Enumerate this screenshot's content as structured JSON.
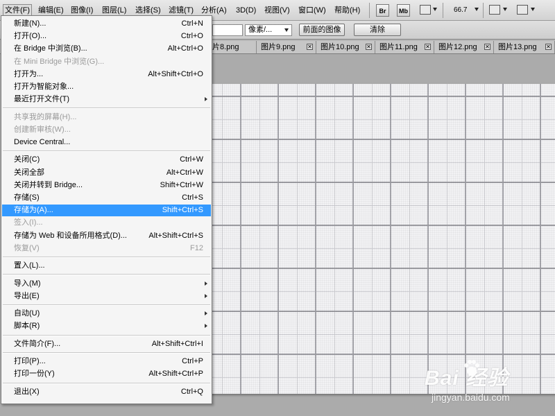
{
  "menubar": {
    "items": [
      "文件(F)",
      "编辑(E)",
      "图像(I)",
      "图层(L)",
      "选择(S)",
      "滤镜(T)",
      "分析(A)",
      "3D(D)",
      "视图(V)",
      "窗口(W)",
      "帮助(H)"
    ],
    "bridge_label": "Br",
    "minibridge_label": "Mb",
    "zoom": "66.7"
  },
  "options": {
    "unit_select": "像素/...",
    "front_image_button": "前面的图像",
    "clear_button": "清除"
  },
  "tabs": [
    "片8.png",
    "图片9.png",
    "图片10.png",
    "图片11.png",
    "图片12.png",
    "图片13.png"
  ],
  "file_menu": {
    "groups": [
      [
        {
          "label": "新建(N)...",
          "shortcut": "Ctrl+N",
          "disabled": false,
          "submenu": false
        },
        {
          "label": "打开(O)...",
          "shortcut": "Ctrl+O",
          "disabled": false,
          "submenu": false
        },
        {
          "label": "在 Bridge 中浏览(B)...",
          "shortcut": "Alt+Ctrl+O",
          "disabled": false,
          "submenu": false
        },
        {
          "label": "在 Mini Bridge 中浏览(G)...",
          "shortcut": "",
          "disabled": true,
          "submenu": false
        },
        {
          "label": "打开为...",
          "shortcut": "Alt+Shift+Ctrl+O",
          "disabled": false,
          "submenu": false
        },
        {
          "label": "打开为智能对象...",
          "shortcut": "",
          "disabled": false,
          "submenu": false
        },
        {
          "label": "最近打开文件(T)",
          "shortcut": "",
          "disabled": false,
          "submenu": true
        }
      ],
      [
        {
          "label": "共享我的屏幕(H)...",
          "shortcut": "",
          "disabled": true,
          "submenu": false
        },
        {
          "label": "创建新审核(W)...",
          "shortcut": "",
          "disabled": true,
          "submenu": false
        },
        {
          "label": "Device Central...",
          "shortcut": "",
          "disabled": false,
          "submenu": false
        }
      ],
      [
        {
          "label": "关闭(C)",
          "shortcut": "Ctrl+W",
          "disabled": false,
          "submenu": false
        },
        {
          "label": "关闭全部",
          "shortcut": "Alt+Ctrl+W",
          "disabled": false,
          "submenu": false
        },
        {
          "label": "关闭并转到 Bridge...",
          "shortcut": "Shift+Ctrl+W",
          "disabled": false,
          "submenu": false
        },
        {
          "label": "存储(S)",
          "shortcut": "Ctrl+S",
          "disabled": false,
          "submenu": false
        },
        {
          "label": "存储为(A)...",
          "shortcut": "Shift+Ctrl+S",
          "disabled": false,
          "submenu": false,
          "highlighted": true
        },
        {
          "label": "签入(I)...",
          "shortcut": "",
          "disabled": true,
          "submenu": false
        },
        {
          "label": "存储为 Web 和设备所用格式(D)...",
          "shortcut": "Alt+Shift+Ctrl+S",
          "disabled": false,
          "submenu": false
        },
        {
          "label": "恢复(V)",
          "shortcut": "F12",
          "disabled": true,
          "submenu": false
        }
      ],
      [
        {
          "label": "置入(L)...",
          "shortcut": "",
          "disabled": false,
          "submenu": false
        }
      ],
      [
        {
          "label": "导入(M)",
          "shortcut": "",
          "disabled": false,
          "submenu": true
        },
        {
          "label": "导出(E)",
          "shortcut": "",
          "disabled": false,
          "submenu": true
        }
      ],
      [
        {
          "label": "自动(U)",
          "shortcut": "",
          "disabled": false,
          "submenu": true
        },
        {
          "label": "脚本(R)",
          "shortcut": "",
          "disabled": false,
          "submenu": true
        }
      ],
      [
        {
          "label": "文件简介(F)...",
          "shortcut": "Alt+Shift+Ctrl+I",
          "disabled": false,
          "submenu": false
        }
      ],
      [
        {
          "label": "打印(P)...",
          "shortcut": "Ctrl+P",
          "disabled": false,
          "submenu": false
        },
        {
          "label": "打印一份(Y)",
          "shortcut": "Alt+Shift+Ctrl+P",
          "disabled": false,
          "submenu": false
        }
      ],
      [
        {
          "label": "退出(X)",
          "shortcut": "Ctrl+Q",
          "disabled": false,
          "submenu": false
        }
      ]
    ]
  },
  "watermark": {
    "logo": "Bai 经验",
    "site": "jingyan.baidu.com"
  },
  "colors": {
    "highlight": "#3399ff",
    "menu_bg": "#f5f5f5",
    "canvas_bg": "#f2f2f4",
    "workarea_bg": "#ababab"
  }
}
